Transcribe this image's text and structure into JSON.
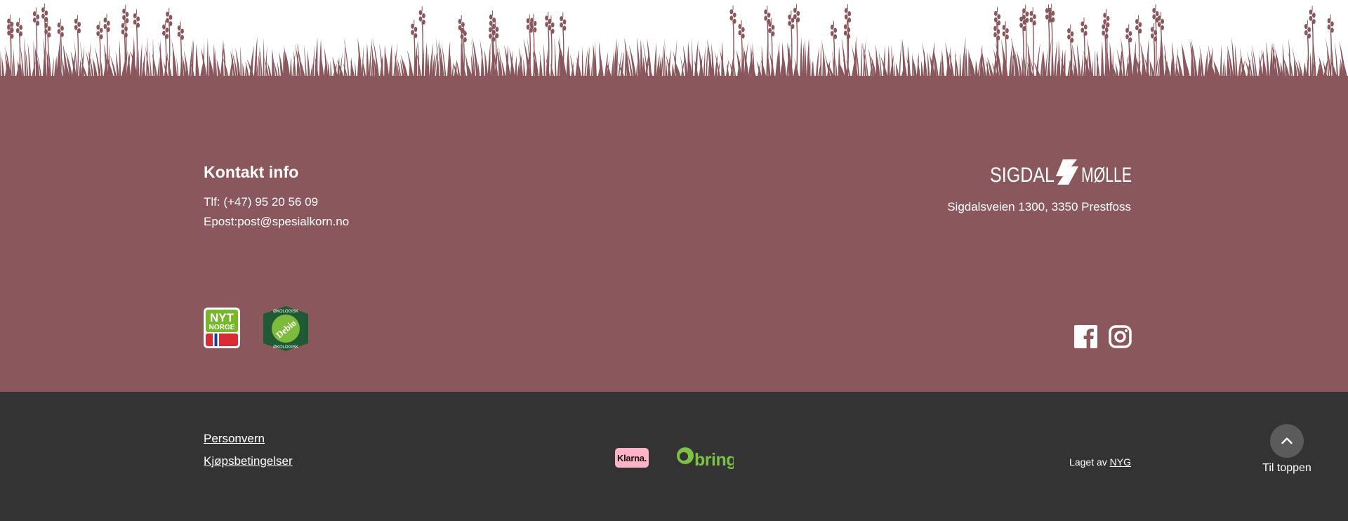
{
  "colors": {
    "footer_bg": "#8a575c",
    "bottom_bar_bg": "#333333",
    "text": "#ffffff",
    "klarna_pink": "#ffb3c7",
    "bring_green": "#7bc144"
  },
  "contact": {
    "heading": "Kontakt info",
    "phone": "Tlf: (+47) 95 20 56 09",
    "email": "Epost:post@spesialkorn.no"
  },
  "brand": {
    "name_left": "SIGDAL",
    "name_right": "MØLLE",
    "address": "Sigdalsveien 1300, 3350 Prestfoss"
  },
  "certifications": {
    "nyt_norge": {
      "line1": "NYT",
      "line2": "NORGE"
    },
    "debio": {
      "center": "Debio",
      "ring": "ØKOLOGISK"
    }
  },
  "social": [
    {
      "icon": "facebook-icon"
    },
    {
      "icon": "instagram-icon"
    }
  ],
  "bottom": {
    "links": [
      "Personvern",
      "Kjøpsbetingelser"
    ],
    "payment": {
      "klarna": "Klarna.",
      "bring": "bring"
    },
    "made_by_prefix": "Laget av",
    "made_by_link": "NYG",
    "to_top_label": "Til toppen"
  }
}
